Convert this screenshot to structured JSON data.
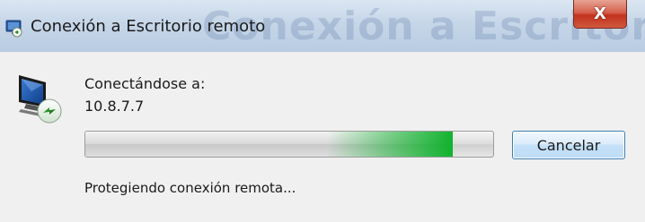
{
  "window": {
    "title": "Conexión a Escritorio remoto",
    "close_label": "X",
    "connecting_label": "Conectándose a:",
    "remote_address": "10.8.7.7",
    "status": "Protegiendo conexión remota...",
    "cancel_label": "Cancelar",
    "progress_glow_position": 0.9,
    "icons": {
      "app": "remote-desktop-icon",
      "main": "computer-monitor-icon"
    },
    "colors": {
      "progress_green": "#06b025",
      "titlebar": "#c6d6e8",
      "close_red": "#c3321d",
      "background": "#f0f0f0"
    }
  }
}
